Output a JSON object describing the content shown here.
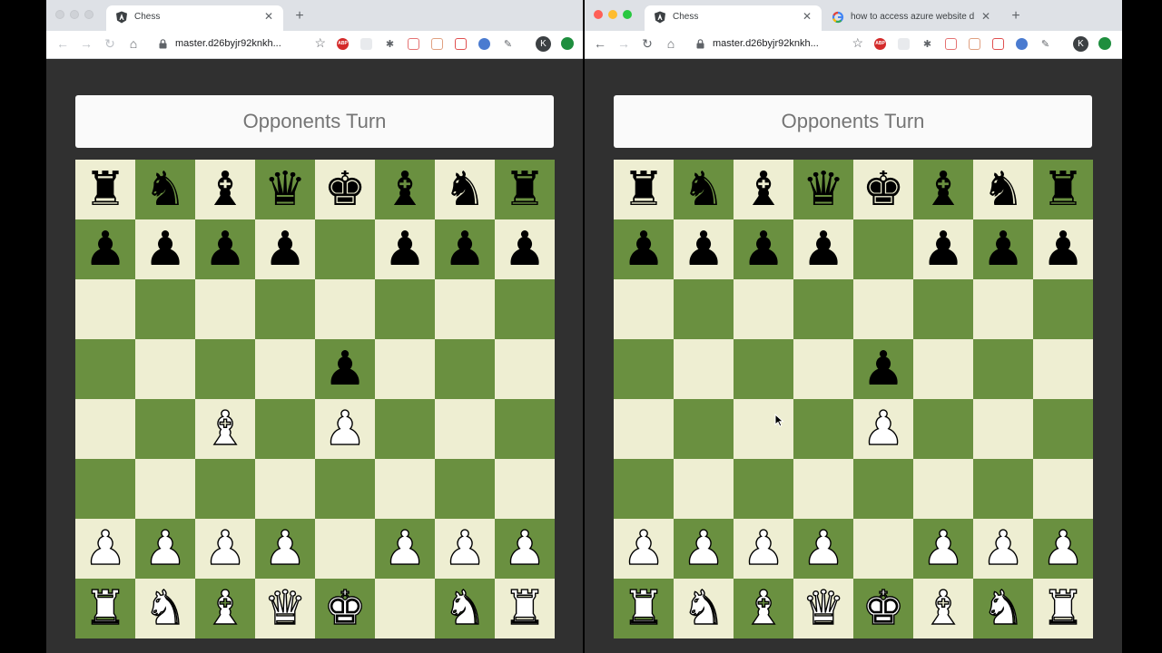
{
  "colors": {
    "board_light": "#eeeed2",
    "board_dark": "#6a9040",
    "page_bg": "#303030",
    "status_bg": "#fafafa",
    "status_text": "#757575"
  },
  "windows": [
    {
      "id": "left",
      "traffic_lights_active": false,
      "tabs": [
        {
          "title": "Chess",
          "icon": "angular-icon",
          "active": true
        }
      ],
      "url": "master.d26byjr92knkh...",
      "status": "Opponents Turn",
      "board": [
        [
          "bR",
          "bN",
          "bB",
          "bQ",
          "bK",
          "bB",
          "bN",
          "bR"
        ],
        [
          "bP",
          "bP",
          "bP",
          "bP",
          "",
          "bP",
          "bP",
          "bP"
        ],
        [
          "",
          "",
          "",
          "",
          "",
          "",
          "",
          ""
        ],
        [
          "",
          "",
          "",
          "",
          "bP",
          "",
          "",
          ""
        ],
        [
          "",
          "",
          "wB",
          "",
          "wP",
          "",
          "",
          ""
        ],
        [
          "",
          "",
          "",
          "",
          "",
          "",
          "",
          ""
        ],
        [
          "wP",
          "wP",
          "wP",
          "wP",
          "",
          "wP",
          "wP",
          "wP"
        ],
        [
          "wR",
          "wN",
          "wB",
          "wQ",
          "wK",
          "",
          "wN",
          "wR"
        ]
      ]
    },
    {
      "id": "right",
      "traffic_lights_active": true,
      "tabs": [
        {
          "title": "Chess",
          "icon": "angular-icon",
          "active": true
        },
        {
          "title": "how to access azure website d",
          "icon": "google-icon",
          "active": false
        }
      ],
      "url": "master.d26byjr92knkh...",
      "status": "Opponents Turn",
      "board": [
        [
          "bR",
          "bN",
          "bB",
          "bQ",
          "bK",
          "bB",
          "bN",
          "bR"
        ],
        [
          "bP",
          "bP",
          "bP",
          "bP",
          "",
          "bP",
          "bP",
          "bP"
        ],
        [
          "",
          "",
          "",
          "",
          "",
          "",
          "",
          ""
        ],
        [
          "",
          "",
          "",
          "",
          "bP",
          "",
          "",
          ""
        ],
        [
          "",
          "",
          "",
          "",
          "wP",
          "",
          "",
          ""
        ],
        [
          "",
          "",
          "",
          "",
          "",
          "",
          "",
          ""
        ],
        [
          "wP",
          "wP",
          "wP",
          "wP",
          "",
          "wP",
          "wP",
          "wP"
        ],
        [
          "wR",
          "wN",
          "wB",
          "wQ",
          "wK",
          "wB",
          "wN",
          "wR"
        ]
      ]
    }
  ],
  "profile_initial": "K",
  "extensions": [
    "adblock-plus-icon",
    "extension-icon",
    "bug-icon",
    "translate-icon",
    "mail-icon",
    "grid-icon",
    "a-icon",
    "wand-icon"
  ]
}
